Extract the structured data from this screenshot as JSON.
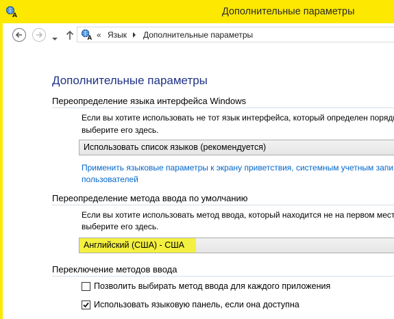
{
  "window": {
    "title": "Дополнительные параметры"
  },
  "address_bar": {
    "overflow": "«",
    "crumbs": [
      "Язык",
      "Дополнительные параметры"
    ]
  },
  "main": {
    "title": "Дополнительные параметры",
    "ui_language": {
      "heading": "Переопределение языка интерфейса Windows",
      "desc_line1": "Если вы хотите использовать не тот язык интерфейса, который определен порядко",
      "desc_line2": "выберите его здесь.",
      "select_value": "Использовать список языков (рекомендуется)",
      "link_line1": "Применить языковые параметры к экрану приветствия, системным учетным запи",
      "link_line2": "пользователей"
    },
    "input_method": {
      "heading": "Переопределение метода ввода по умолчанию",
      "desc_line1": "Если вы хотите использовать метод ввода, который находится не на первом месте",
      "desc_line2": "выберите его здесь.",
      "select_value": "Английский (США) - США"
    },
    "switching": {
      "heading": "Переключение методов ввода",
      "options": [
        {
          "label": "Позволить выбирать метод ввода для каждого приложения",
          "checked": false
        },
        {
          "label": "Использовать языковую панель, если она доступна",
          "checked": true
        }
      ]
    }
  },
  "colors": {
    "title_bar": "#fce800",
    "heading_blue": "#1e3287",
    "link_blue": "#0066cc",
    "highlight": "#f4f040"
  }
}
